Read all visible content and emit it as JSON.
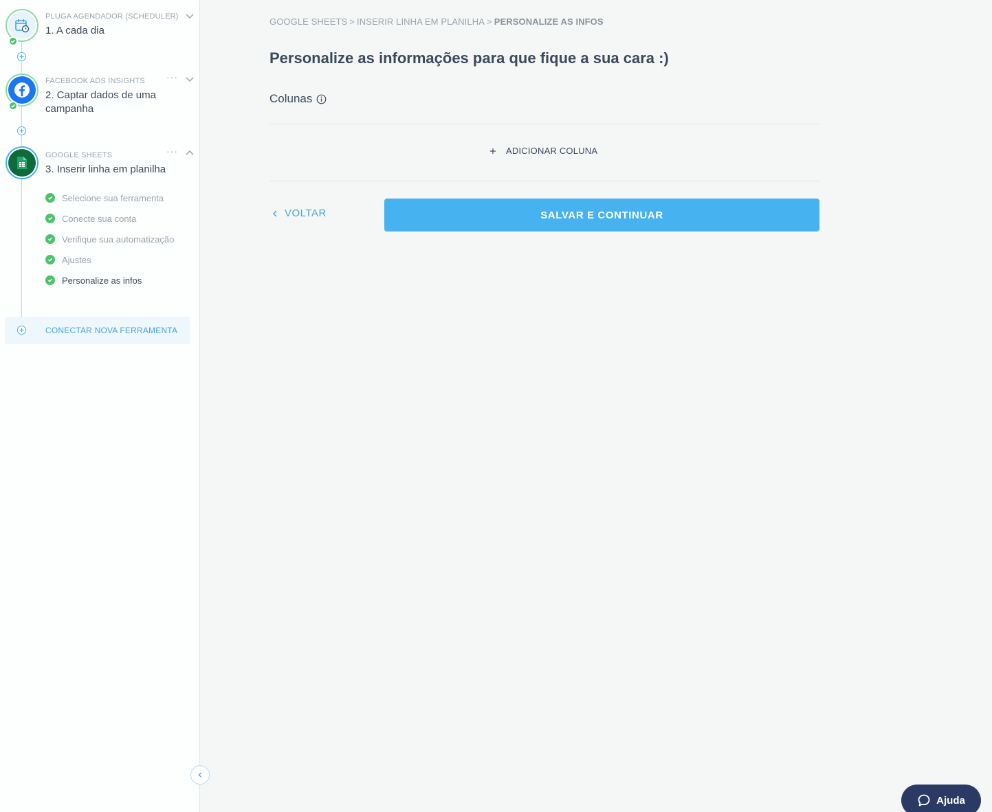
{
  "sidebar": {
    "steps": [
      {
        "kicker": "PLUGA AGENDADOR (SCHEDULER)",
        "title": "1. A cada dia",
        "icon": "calendar-clock-icon"
      },
      {
        "kicker": "FACEBOOK ADS INSIGHTS",
        "title": "2. Captar dados de uma campanha",
        "icon": "facebook-icon",
        "more": "···"
      },
      {
        "kicker": "GOOGLE SHEETS",
        "title": "3. Inserir linha em planilha",
        "icon": "google-sheets-icon",
        "more": "···"
      }
    ],
    "substeps": [
      {
        "label": "Selecione sua ferramenta"
      },
      {
        "label": "Conecte sua conta"
      },
      {
        "label": "Verifique sua automatização"
      },
      {
        "label": "Ajustes"
      },
      {
        "label": "Personalize as infos"
      }
    ],
    "connect_new": "CONECTAR NOVA FERRAMENTA"
  },
  "breadcrumb": {
    "items": [
      "GOOGLE SHEETS",
      "INSERIR LINHA EM PLANILHA",
      "PERSONALIZE AS INFOS"
    ],
    "separator": ">"
  },
  "main": {
    "title": "Personalize as informações para que fique a sua cara :)",
    "columns_label": "Colunas",
    "add_column_label": "ADICIONAR COLUNA",
    "back_label": "VOLTAR",
    "save_label": "SALVAR E CONTINUAR"
  },
  "help": {
    "label": "Ajuda"
  },
  "colors": {
    "accent": "#46b3f0",
    "success": "#4cc36b",
    "facebook": "#1877f2",
    "sheets": "#0f9d58",
    "help_bg": "#2b3a64"
  }
}
